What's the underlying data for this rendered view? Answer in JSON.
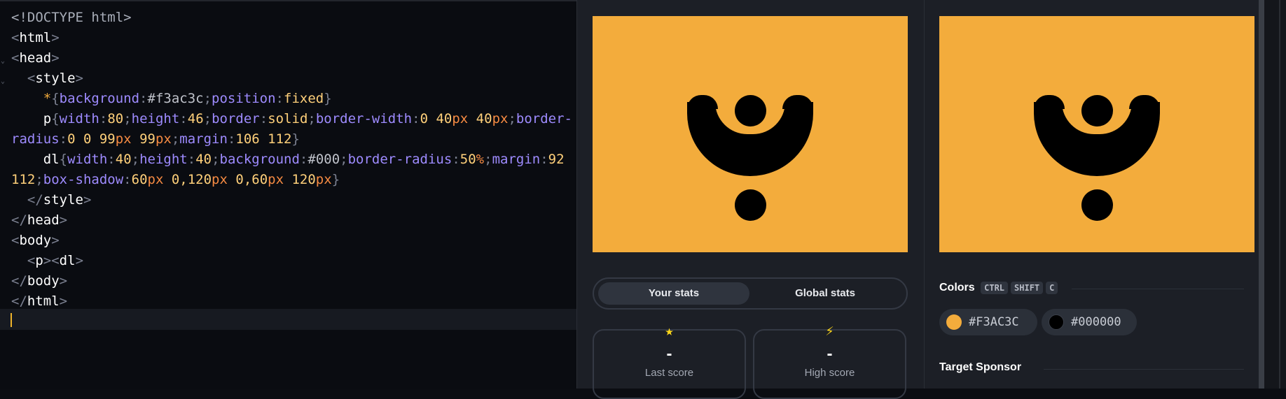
{
  "editor": {
    "lines": [
      [
        {
          "t": "<!DOCTYPE html>",
          "c": "c-doctype"
        }
      ],
      [
        {
          "t": "<",
          "c": "c-punct"
        },
        {
          "t": "html",
          "c": "c-tag"
        },
        {
          "t": ">",
          "c": "c-punct"
        }
      ],
      [
        {
          "t": "<",
          "c": "c-punct"
        },
        {
          "t": "head",
          "c": "c-tag"
        },
        {
          "t": ">",
          "c": "c-punct"
        }
      ],
      [
        {
          "t": "  <",
          "c": "c-punct"
        },
        {
          "t": "style",
          "c": "c-tag"
        },
        {
          "t": ">",
          "c": "c-punct"
        }
      ],
      [
        {
          "t": "    *",
          "c": "c-sel"
        },
        {
          "t": "{",
          "c": "c-punct"
        },
        {
          "t": "background",
          "c": "c-prop"
        },
        {
          "t": ":",
          "c": "c-punct"
        },
        {
          "t": "#f3ac3c",
          "c": "c-hex"
        },
        {
          "t": ";",
          "c": "c-punct"
        },
        {
          "t": "position",
          "c": "c-prop"
        },
        {
          "t": ":",
          "c": "c-punct"
        },
        {
          "t": "fixed",
          "c": "c-val"
        },
        {
          "t": "}",
          "c": "c-punct"
        }
      ],
      [
        {
          "t": "    p",
          "c": "c-tag"
        },
        {
          "t": "{",
          "c": "c-punct"
        },
        {
          "t": "width",
          "c": "c-prop"
        },
        {
          "t": ":",
          "c": "c-punct"
        },
        {
          "t": "80",
          "c": "c-num"
        },
        {
          "t": ";",
          "c": "c-punct"
        },
        {
          "t": "height",
          "c": "c-prop"
        },
        {
          "t": ":",
          "c": "c-punct"
        },
        {
          "t": "46",
          "c": "c-num"
        },
        {
          "t": ";",
          "c": "c-punct"
        },
        {
          "t": "border",
          "c": "c-prop"
        },
        {
          "t": ":",
          "c": "c-punct"
        },
        {
          "t": "solid",
          "c": "c-val"
        },
        {
          "t": ";",
          "c": "c-punct"
        },
        {
          "t": "border-width",
          "c": "c-prop"
        },
        {
          "t": ":",
          "c": "c-punct"
        },
        {
          "t": "0 40",
          "c": "c-num"
        },
        {
          "t": "px",
          "c": "c-unit"
        },
        {
          "t": " 40",
          "c": "c-num"
        },
        {
          "t": "px",
          "c": "c-unit"
        },
        {
          "t": ";",
          "c": "c-punct"
        },
        {
          "t": "border-",
          "c": "c-prop"
        }
      ],
      [
        {
          "t": "radius",
          "c": "c-prop"
        },
        {
          "t": ":",
          "c": "c-punct"
        },
        {
          "t": "0 0 99",
          "c": "c-num"
        },
        {
          "t": "px",
          "c": "c-unit"
        },
        {
          "t": " 99",
          "c": "c-num"
        },
        {
          "t": "px",
          "c": "c-unit"
        },
        {
          "t": ";",
          "c": "c-punct"
        },
        {
          "t": "margin",
          "c": "c-prop"
        },
        {
          "t": ":",
          "c": "c-punct"
        },
        {
          "t": "106 112",
          "c": "c-num"
        },
        {
          "t": "}",
          "c": "c-punct"
        }
      ],
      [
        {
          "t": "    dl",
          "c": "c-tag"
        },
        {
          "t": "{",
          "c": "c-punct"
        },
        {
          "t": "width",
          "c": "c-prop"
        },
        {
          "t": ":",
          "c": "c-punct"
        },
        {
          "t": "40",
          "c": "c-num"
        },
        {
          "t": ";",
          "c": "c-punct"
        },
        {
          "t": "height",
          "c": "c-prop"
        },
        {
          "t": ":",
          "c": "c-punct"
        },
        {
          "t": "40",
          "c": "c-num"
        },
        {
          "t": ";",
          "c": "c-punct"
        },
        {
          "t": "background",
          "c": "c-prop"
        },
        {
          "t": ":",
          "c": "c-punct"
        },
        {
          "t": "#000",
          "c": "c-hex"
        },
        {
          "t": ";",
          "c": "c-punct"
        },
        {
          "t": "border-radius",
          "c": "c-prop"
        },
        {
          "t": ":",
          "c": "c-punct"
        },
        {
          "t": "50",
          "c": "c-num"
        },
        {
          "t": "%",
          "c": "c-unit"
        },
        {
          "t": ";",
          "c": "c-punct"
        },
        {
          "t": "margin",
          "c": "c-prop"
        },
        {
          "t": ":",
          "c": "c-punct"
        },
        {
          "t": "92",
          "c": "c-num"
        }
      ],
      [
        {
          "t": "112",
          "c": "c-num"
        },
        {
          "t": ";",
          "c": "c-punct"
        },
        {
          "t": "box-shadow",
          "c": "c-prop"
        },
        {
          "t": ":",
          "c": "c-punct"
        },
        {
          "t": "60",
          "c": "c-num"
        },
        {
          "t": "px",
          "c": "c-unit"
        },
        {
          "t": " 0,120",
          "c": "c-num"
        },
        {
          "t": "px",
          "c": "c-unit"
        },
        {
          "t": " 0,60",
          "c": "c-num"
        },
        {
          "t": "px",
          "c": "c-unit"
        },
        {
          "t": " 120",
          "c": "c-num"
        },
        {
          "t": "px",
          "c": "c-unit"
        },
        {
          "t": "}",
          "c": "c-punct"
        }
      ],
      [
        {
          "t": "  </",
          "c": "c-punct"
        },
        {
          "t": "style",
          "c": "c-tag"
        },
        {
          "t": ">",
          "c": "c-punct"
        }
      ],
      [
        {
          "t": "</",
          "c": "c-punct"
        },
        {
          "t": "head",
          "c": "c-tag"
        },
        {
          "t": ">",
          "c": "c-punct"
        }
      ],
      [
        {
          "t": "<",
          "c": "c-punct"
        },
        {
          "t": "body",
          "c": "c-tag"
        },
        {
          "t": ">",
          "c": "c-punct"
        }
      ],
      [
        {
          "t": "  <",
          "c": "c-punct"
        },
        {
          "t": "p",
          "c": "c-tag"
        },
        {
          "t": "><",
          "c": "c-punct"
        },
        {
          "t": "dl",
          "c": "c-tag"
        },
        {
          "t": ">",
          "c": "c-punct"
        }
      ],
      [
        {
          "t": "</",
          "c": "c-punct"
        },
        {
          "t": "body",
          "c": "c-tag"
        },
        {
          "t": ">",
          "c": "c-punct"
        }
      ],
      [
        {
          "t": "</",
          "c": "c-punct"
        },
        {
          "t": "html",
          "c": "c-tag"
        },
        {
          "t": ">",
          "c": "c-punct"
        }
      ]
    ]
  },
  "stats": {
    "your_label": "Your stats",
    "global_label": "Global stats",
    "last_score_value": "-",
    "last_score_label": "Last score",
    "high_score_value": "-",
    "high_score_label": "High score",
    "star_icon": "★",
    "bolt_icon": "⚡"
  },
  "colors": {
    "title": "Colors",
    "shortcut": [
      "CTRL",
      "SHIFT",
      "C"
    ],
    "swatches": [
      {
        "hex": "#F3AC3C",
        "color": "#f3ac3c"
      },
      {
        "hex": "#000000",
        "color": "#000000"
      }
    ]
  },
  "sponsor": {
    "title": "Target Sponsor"
  }
}
